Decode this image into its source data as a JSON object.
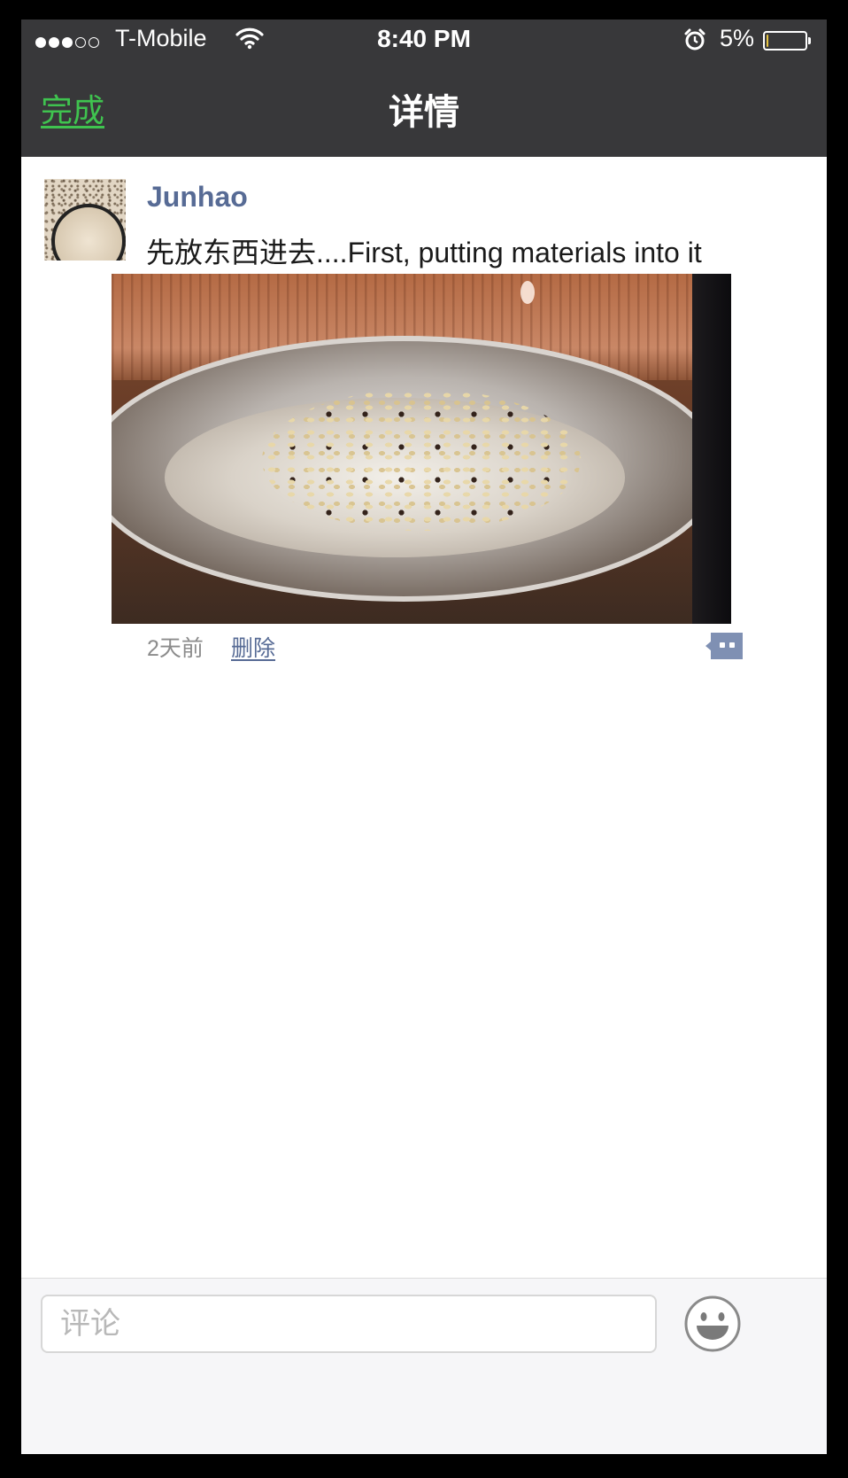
{
  "status_bar": {
    "carrier": "T-Mobile",
    "time": "8:40 PM",
    "battery_percent": "5%",
    "battery_level": 0.05,
    "signal_bars": 3,
    "signal_total": 5
  },
  "nav": {
    "done_label": "完成",
    "title": "详情"
  },
  "post": {
    "username": "Junhao",
    "text": "先放东西进去....First, putting materials into it",
    "time_ago": "2天前",
    "delete_label": "删除"
  },
  "comment_bar": {
    "placeholder": "评论"
  },
  "colors": {
    "nav_background": "#38383a",
    "accent_green": "#3fc34f",
    "link_blue": "#576b95"
  }
}
